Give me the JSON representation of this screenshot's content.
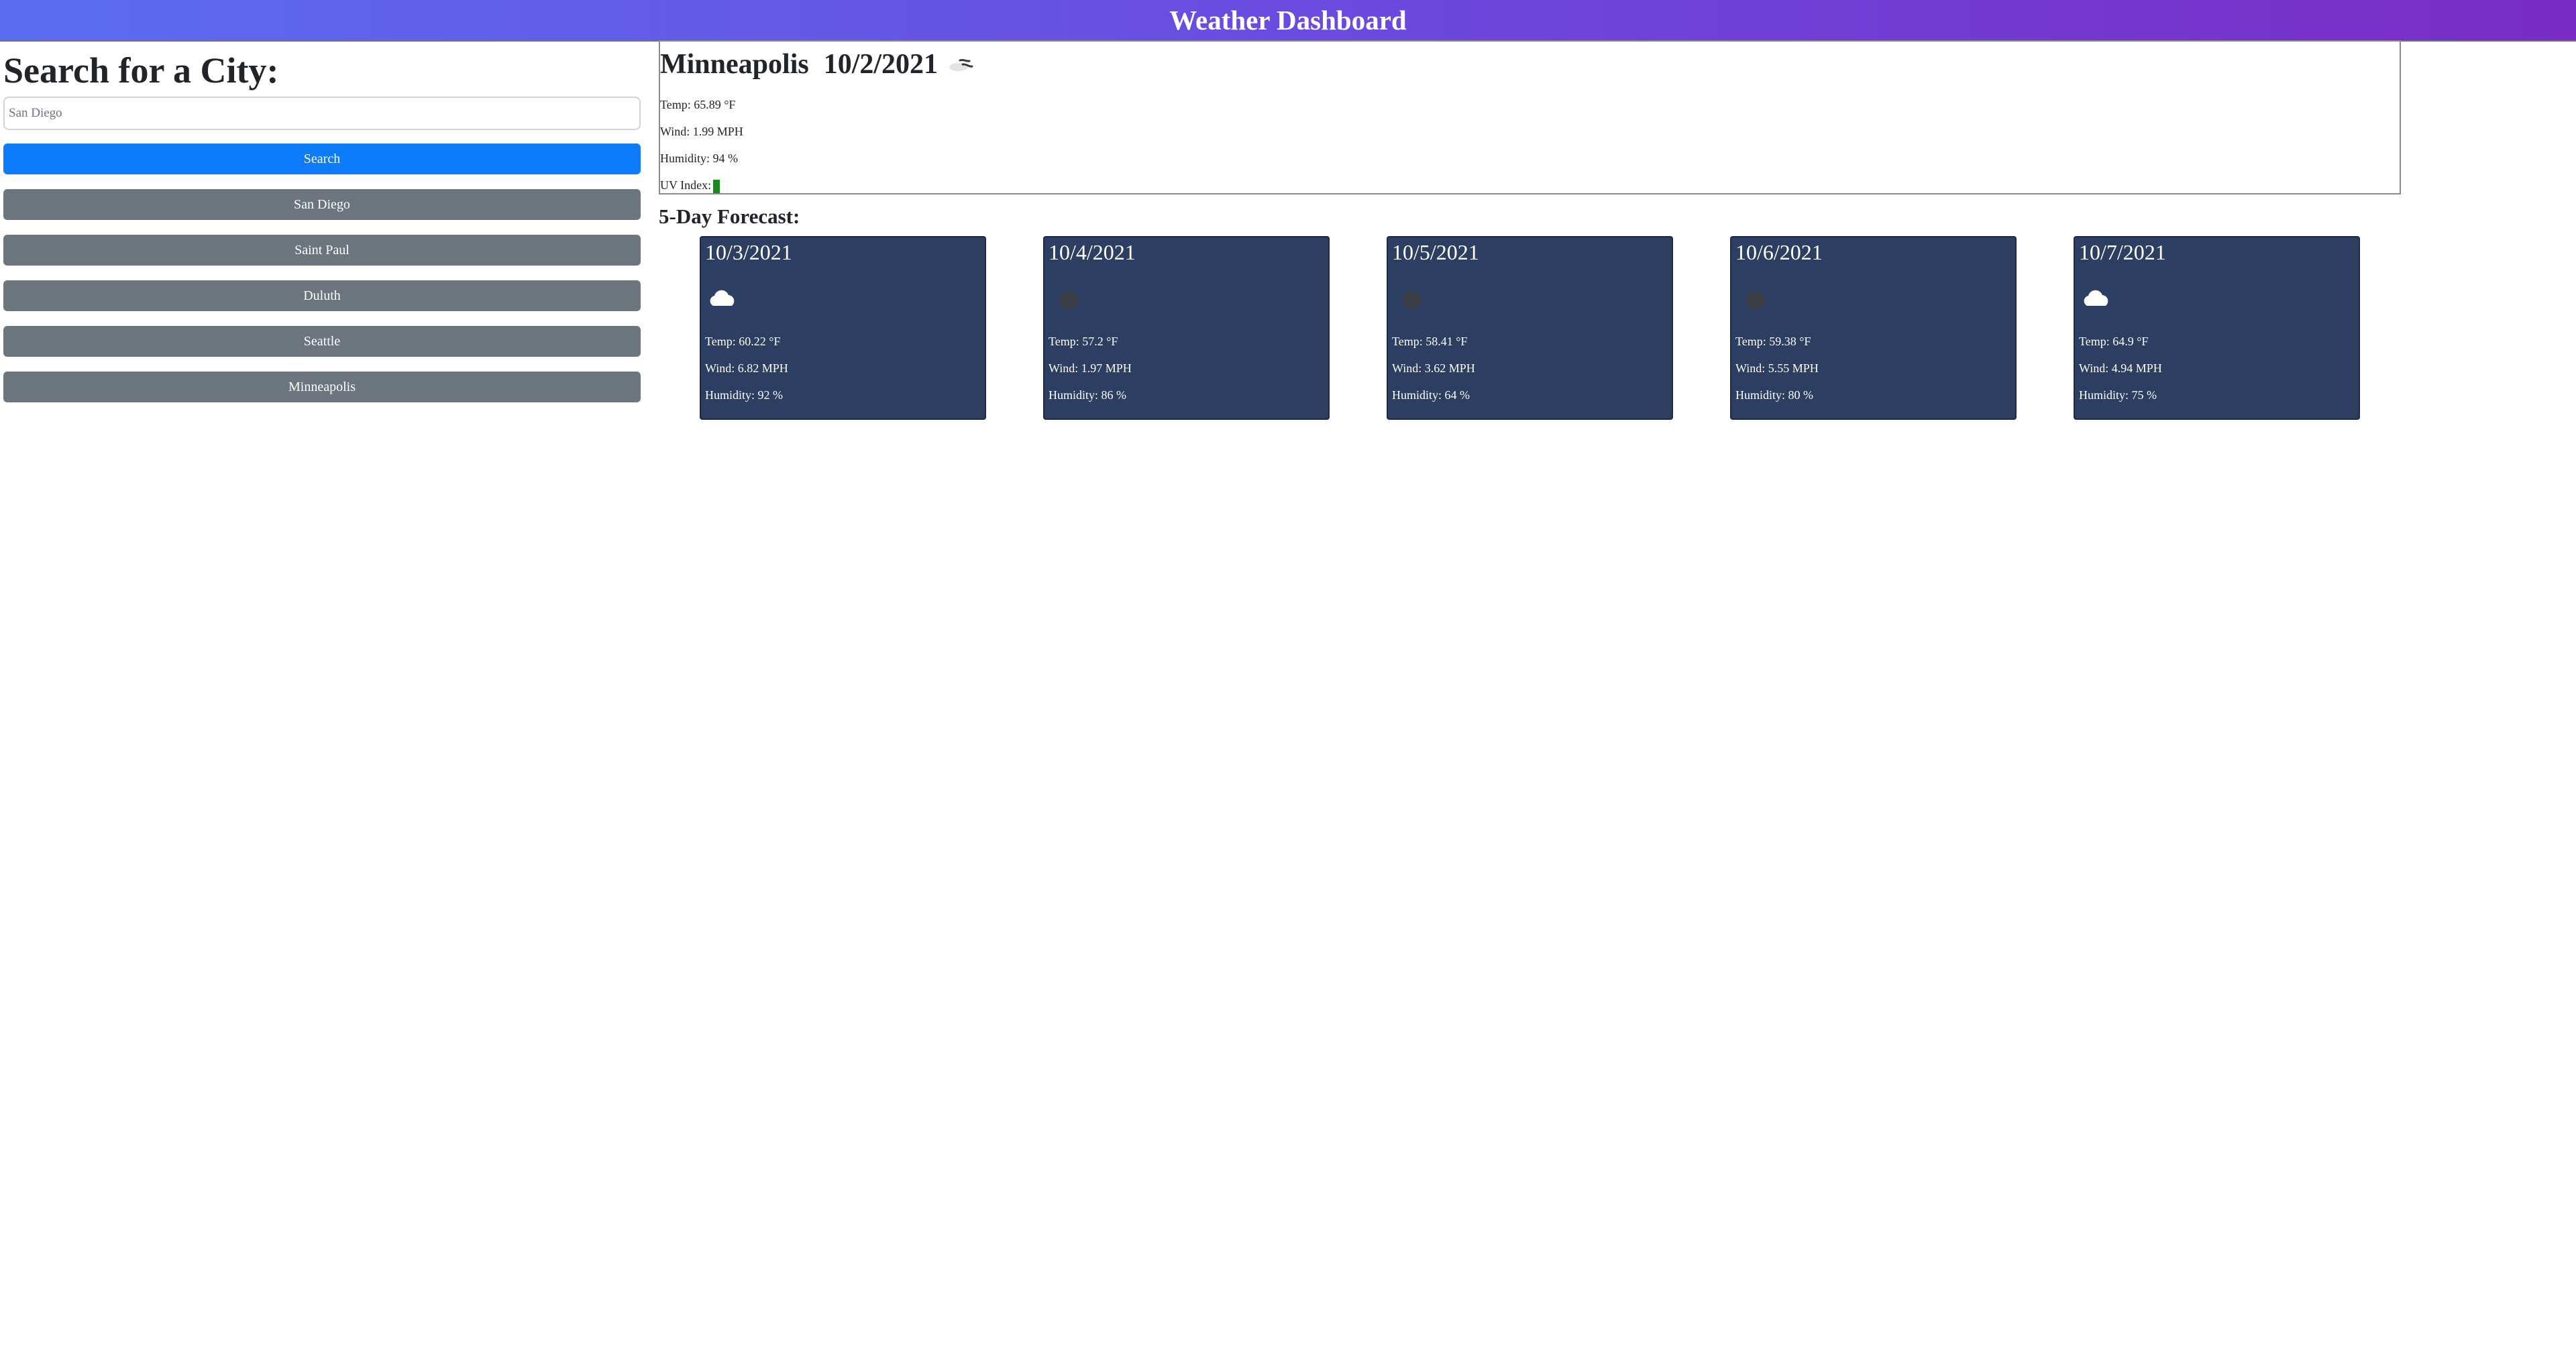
{
  "header": {
    "title": "Weather Dashboard"
  },
  "sidebar": {
    "heading": "Search for a City:",
    "search": {
      "value": "",
      "placeholder": "San Diego"
    },
    "search_button": "Search",
    "history": [
      "San Diego",
      "Saint Paul",
      "Duluth",
      "Seattle",
      "Minneapolis"
    ]
  },
  "current": {
    "city": "Minneapolis",
    "date": "10/2/2021",
    "icon": "wind-icon",
    "temp": "Temp: 65.89 °F",
    "wind": "Wind: 1.99 MPH",
    "humidity": "Humidity: 94 %",
    "uv_label": "UV Index:",
    "uv_color": "#1a8a1a"
  },
  "forecast": {
    "title": "5-Day Forecast:",
    "days": [
      {
        "date": "10/3/2021",
        "icon": "cloud-icon",
        "temp": "Temp: 60.22 °F",
        "wind": "Wind: 6.82 MPH",
        "humidity": "Humidity: 92 %"
      },
      {
        "date": "10/4/2021",
        "icon": "rain-icon",
        "temp": "Temp: 57.2 °F",
        "wind": "Wind: 1.97 MPH",
        "humidity": "Humidity: 86 %"
      },
      {
        "date": "10/5/2021",
        "icon": "rain-icon",
        "temp": "Temp: 58.41 °F",
        "wind": "Wind: 3.62 MPH",
        "humidity": "Humidity: 64 %"
      },
      {
        "date": "10/6/2021",
        "icon": "rain-icon",
        "temp": "Temp: 59.38 °F",
        "wind": "Wind: 5.55 MPH",
        "humidity": "Humidity: 80 %"
      },
      {
        "date": "10/7/2021",
        "icon": "cloud-icon",
        "temp": "Temp: 64.9 °F",
        "wind": "Wind: 4.94 MPH",
        "humidity": "Humidity: 75 %"
      }
    ]
  },
  "colors": {
    "header_gradient_start": "#5b6cf2",
    "header_gradient_end": "#7a2cc4",
    "primary_button": "#0d7bfa",
    "history_button": "#6c757d",
    "card_background": "#2c3e61"
  }
}
